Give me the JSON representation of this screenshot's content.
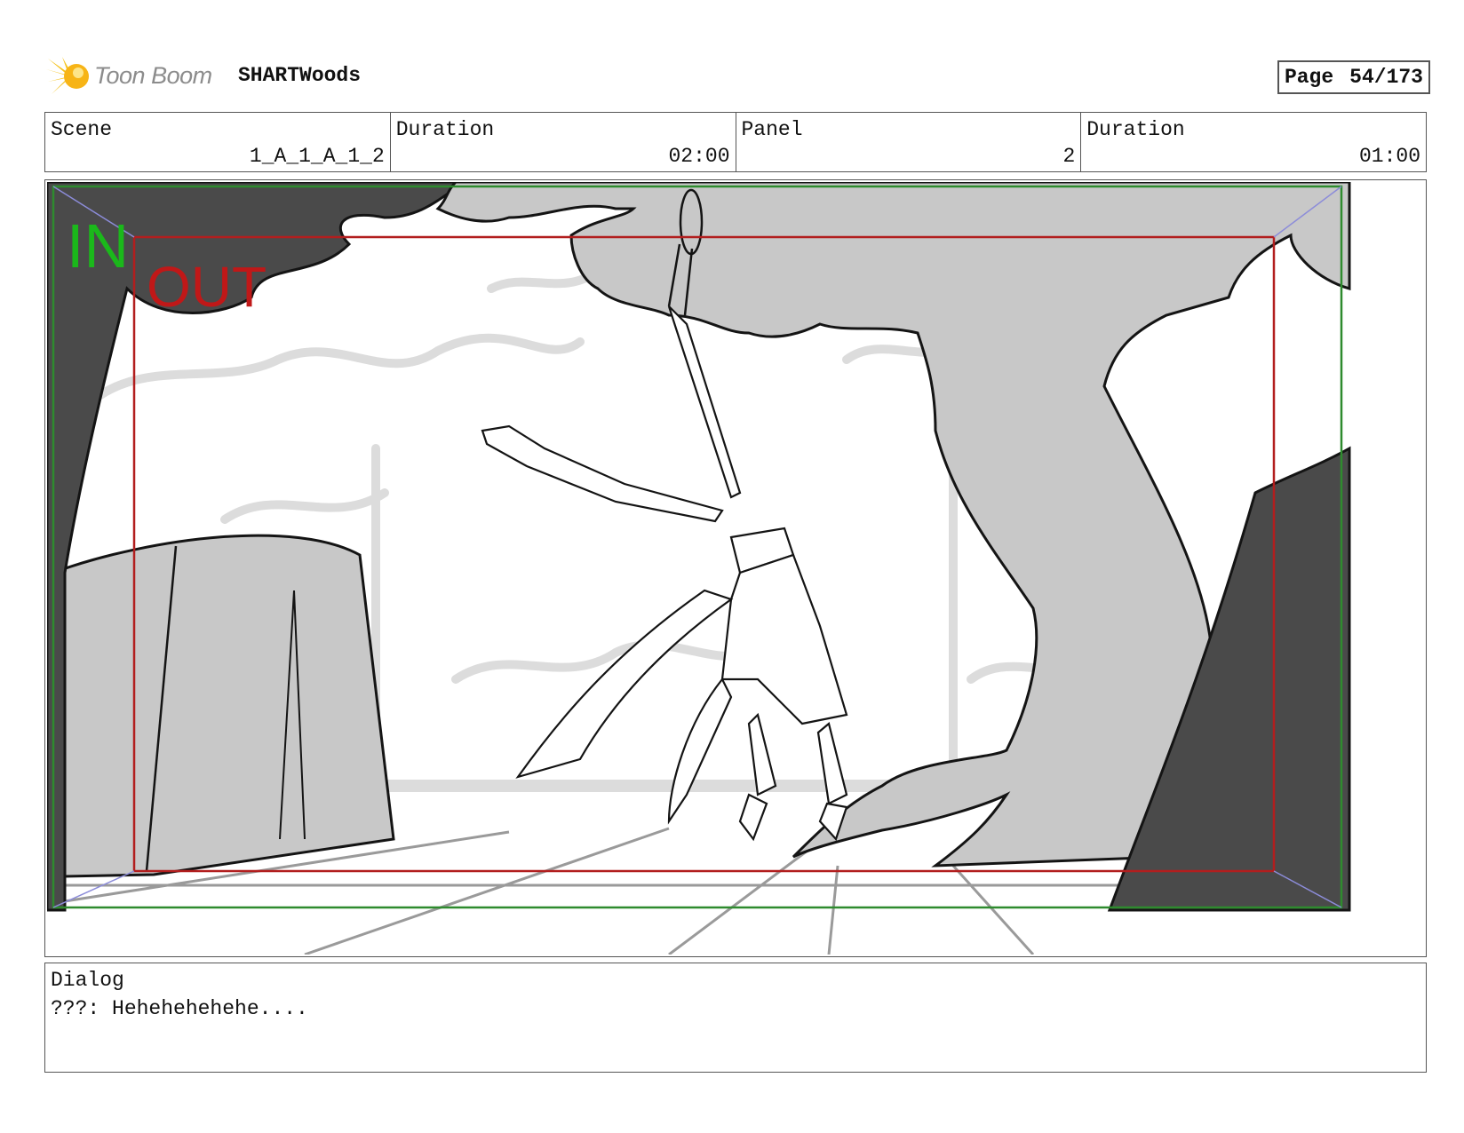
{
  "header": {
    "logo_text": "Toon Boom",
    "project_title": "SHARTWoods",
    "page_label": "Page",
    "page_number": "54/173"
  },
  "info": [
    {
      "label": "Scene",
      "value": "1_A_1_A_1_2"
    },
    {
      "label": "Duration",
      "value": "02:00"
    },
    {
      "label": "Panel",
      "value": "2"
    },
    {
      "label": "Duration",
      "value": "01:00"
    }
  ],
  "panel": {
    "in_label": "IN",
    "out_label": "OUT",
    "colors": {
      "in_frame": "#2e8b2e",
      "in_text": "#1bb81b",
      "out_frame": "#b21e1e",
      "out_text": "#c01818",
      "dark_fill": "#4a4a4a",
      "mid_fill": "#c8c8c8",
      "bg_sketch": "#dcdcdc",
      "line": "#141414",
      "ground_line": "#9a9a9a",
      "corner_arrow": "#8c8cd9"
    },
    "icons": [
      "toon-boom-logo-icon"
    ]
  },
  "dialog": {
    "label": "Dialog",
    "text": "???: Hehehehehehe...."
  }
}
